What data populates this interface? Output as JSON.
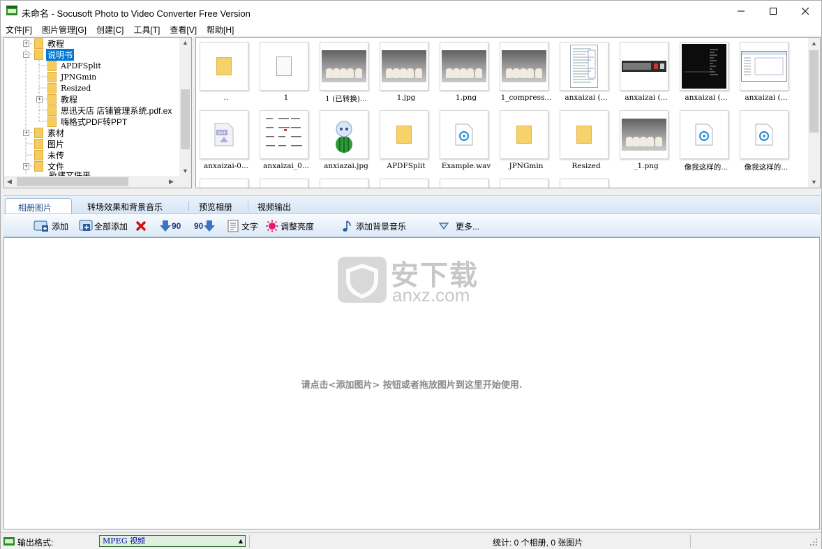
{
  "window": {
    "title": "未命名 - Socusoft Photo to Video Converter Free Version",
    "minimize_icon": "minimize-icon",
    "maximize_icon": "maximize-icon",
    "close_icon": "close-icon"
  },
  "menu": [
    "文件[F]",
    "图片管理[G]",
    "创建[C]",
    "工具[T]",
    "查看[V]",
    "帮助[H]"
  ],
  "tree": {
    "items": [
      {
        "label": "教程",
        "cjk": true
      },
      {
        "label": "说明书",
        "cjk": true,
        "selected": true
      },
      {
        "label": "APDFSplit",
        "cjk": false
      },
      {
        "label": "JPNGmin",
        "cjk": false
      },
      {
        "label": "Resized",
        "cjk": false
      },
      {
        "label": "教程",
        "cjk": true
      },
      {
        "label": "思迅天店 店铺管理系统.pdf.ex",
        "cjk": true
      },
      {
        "label": "嗨格式PDF转PPT",
        "cjk": true
      },
      {
        "label": "素材",
        "cjk": true
      },
      {
        "label": "图片",
        "cjk": true
      },
      {
        "label": "未传",
        "cjk": true
      },
      {
        "label": "文件",
        "cjk": true
      },
      {
        "label": "新建文件夹",
        "cjk": true
      }
    ]
  },
  "thumbnails": [
    {
      "caption": "..",
      "kind": "folder"
    },
    {
      "caption": "1",
      "kind": "file"
    },
    {
      "caption": "1 (已转换)...",
      "kind": "photo"
    },
    {
      "caption": "1.jpg",
      "kind": "photo"
    },
    {
      "caption": "1.png",
      "kind": "photo"
    },
    {
      "caption": "1_compress...",
      "kind": "photo"
    },
    {
      "caption": "anxaizai (...",
      "kind": "screenshot-doc"
    },
    {
      "caption": "anxaizai (...",
      "kind": "screenshot-bar"
    },
    {
      "caption": "anxaizai (...",
      "kind": "screenshot-dark"
    },
    {
      "caption": "anxaizai (...",
      "kind": "screenshot-window"
    },
    {
      "caption": "anxaizai-0...",
      "kind": "bmp"
    },
    {
      "caption": "anxaizai_0...",
      "kind": "text-doc"
    },
    {
      "caption": "anxiazai.jpg",
      "kind": "mascot"
    },
    {
      "caption": "APDFSplit",
      "kind": "folder"
    },
    {
      "caption": "Example.wav",
      "kind": "audio"
    },
    {
      "caption": "JPNGmin",
      "kind": "folder"
    },
    {
      "caption": "Resized",
      "kind": "folder"
    },
    {
      "caption": "_1.png",
      "kind": "photo"
    },
    {
      "caption": "像我这样的...",
      "kind": "audio"
    },
    {
      "caption": "像我这样的...",
      "kind": "audio"
    }
  ],
  "tabs": [
    "相册图片",
    "转场效果和背景音乐",
    "预览相册",
    "视频输出"
  ],
  "toolbar": {
    "add": "添加",
    "add_all": "全部添加",
    "rotate_left": "90",
    "rotate_right": "90",
    "text": "文字",
    "brightness": "调整亮度",
    "add_music": "添加背景音乐",
    "more": "更多..."
  },
  "canvas": {
    "watermark_cn": "安下载",
    "watermark_en": "anxz.com",
    "hint": "请点击<添加图片> 按钮或者拖放图片到这里开始使用."
  },
  "status": {
    "format_label": "输出格式:",
    "format_value": "MPEG 视频",
    "stats": "统计: 0 个相册, 0 张图片"
  }
}
